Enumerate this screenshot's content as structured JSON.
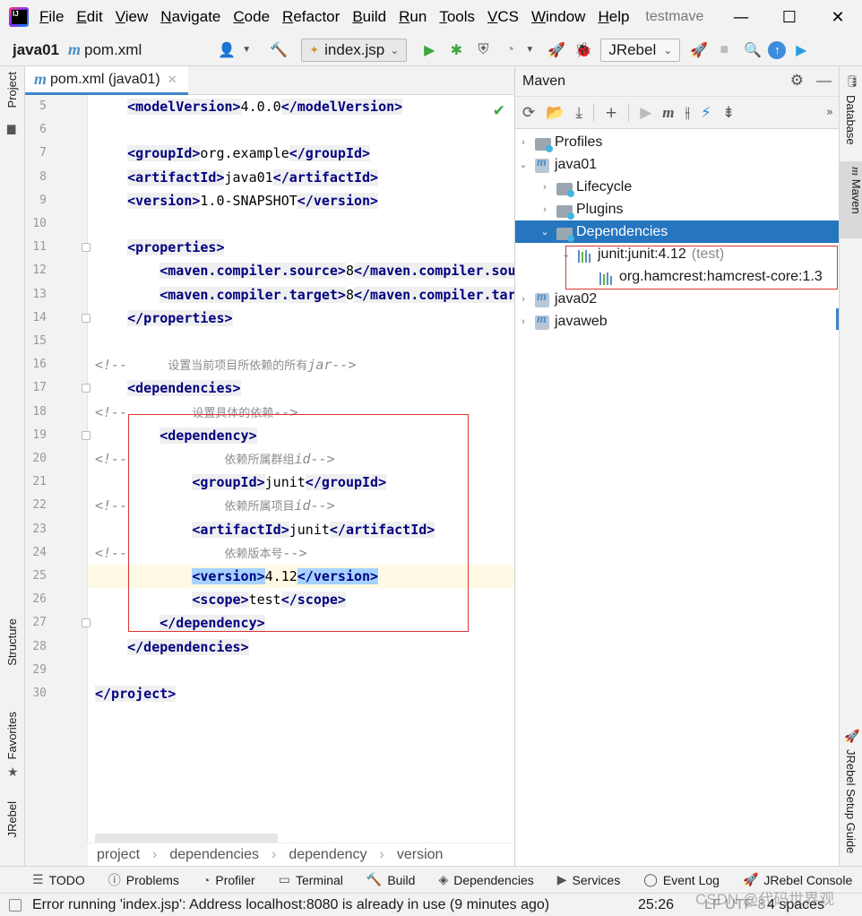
{
  "menubar": {
    "items": [
      "File",
      "Edit",
      "View",
      "Navigate",
      "Code",
      "Refactor",
      "Build",
      "Run",
      "Tools",
      "VCS",
      "Window",
      "Help"
    ],
    "project_title": "testmave"
  },
  "toolbar": {
    "project": "java01",
    "file": "pom.xml",
    "run_config": "index.jsp",
    "jrebel": "JRebel"
  },
  "editor": {
    "tab": "pom.xml (java01)",
    "lines": [
      {
        "n": "5",
        "parts": [
          [
            "tag",
            "<modelVersion>"
          ],
          [
            "txt",
            "4.0.0"
          ],
          [
            "tag",
            "</modelVersion>"
          ]
        ],
        "indent": 4
      },
      {
        "n": "6",
        "parts": [],
        "indent": 0
      },
      {
        "n": "7",
        "parts": [
          [
            "tag",
            "<groupId>"
          ],
          [
            "txt",
            "org.example"
          ],
          [
            "tag",
            "</groupId>"
          ]
        ],
        "indent": 4
      },
      {
        "n": "8",
        "parts": [
          [
            "tag",
            "<artifactId>"
          ],
          [
            "txt",
            "java01"
          ],
          [
            "tag",
            "</artifactId>"
          ]
        ],
        "indent": 4
      },
      {
        "n": "9",
        "parts": [
          [
            "tag",
            "<version>"
          ],
          [
            "txt",
            "1.0-SNAPSHOT"
          ],
          [
            "tag",
            "</version>"
          ]
        ],
        "indent": 4
      },
      {
        "n": "10",
        "parts": [],
        "indent": 0
      },
      {
        "n": "11",
        "parts": [
          [
            "tag",
            "<properties>"
          ]
        ],
        "indent": 4
      },
      {
        "n": "12",
        "parts": [
          [
            "tag",
            "<maven.compiler.source>"
          ],
          [
            "txt",
            "8"
          ],
          [
            "tag",
            "</maven.compiler.sou"
          ]
        ],
        "indent": 8
      },
      {
        "n": "13",
        "parts": [
          [
            "tag",
            "<maven.compiler.target>"
          ],
          [
            "txt",
            "8"
          ],
          [
            "tag",
            "</maven.compiler.tar"
          ]
        ],
        "indent": 8
      },
      {
        "n": "14",
        "parts": [
          [
            "tag",
            "</properties>"
          ]
        ],
        "indent": 4
      },
      {
        "n": "15",
        "parts": [],
        "indent": 0
      },
      {
        "n": "16",
        "parts": [
          [
            "cmt",
            "<!--     "
          ],
          [
            "cmt-cjk",
            "设置当前项目所依赖的所有"
          ],
          [
            "cmt",
            "jar-->"
          ]
        ],
        "indent": 0
      },
      {
        "n": "17",
        "parts": [
          [
            "tag",
            "<dependencies>"
          ]
        ],
        "indent": 4
      },
      {
        "n": "18",
        "parts": [
          [
            "cmt",
            "<!--        "
          ],
          [
            "cmt-cjk",
            "设置具体的依赖"
          ],
          [
            "cmt",
            "-->"
          ]
        ],
        "indent": 0
      },
      {
        "n": "19",
        "parts": [
          [
            "tag",
            "<dependency>"
          ]
        ],
        "indent": 8
      },
      {
        "n": "20",
        "parts": [
          [
            "cmt",
            "<!--            "
          ],
          [
            "cmt-cjk",
            "依赖所属群组"
          ],
          [
            "cmt",
            "id-->"
          ]
        ],
        "indent": 0
      },
      {
        "n": "21",
        "parts": [
          [
            "tag",
            "<groupId>"
          ],
          [
            "txt",
            "junit"
          ],
          [
            "tag",
            "</groupId>"
          ]
        ],
        "indent": 12
      },
      {
        "n": "22",
        "parts": [
          [
            "cmt",
            "<!--            "
          ],
          [
            "cmt-cjk",
            "依赖所属项目"
          ],
          [
            "cmt",
            "id-->"
          ]
        ],
        "indent": 0
      },
      {
        "n": "23",
        "parts": [
          [
            "tag",
            "<artifactId>"
          ],
          [
            "txt",
            "junit"
          ],
          [
            "tag",
            "</artifactId>"
          ]
        ],
        "indent": 12
      },
      {
        "n": "24",
        "parts": [
          [
            "cmt",
            "<!--            "
          ],
          [
            "cmt-cjk",
            "依赖版本号"
          ],
          [
            "cmt",
            "-->"
          ]
        ],
        "indent": 0
      },
      {
        "n": "25",
        "parts": [
          [
            "tagsel",
            "<version>"
          ],
          [
            "txt",
            "4.12"
          ],
          [
            "tagsel",
            "</version>"
          ]
        ],
        "indent": 12
      },
      {
        "n": "26",
        "parts": [
          [
            "tag",
            "<scope>"
          ],
          [
            "txt",
            "test"
          ],
          [
            "tag",
            "</scope>"
          ]
        ],
        "indent": 12
      },
      {
        "n": "27",
        "parts": [
          [
            "tag",
            "</dependency>"
          ]
        ],
        "indent": 8
      },
      {
        "n": "28",
        "parts": [
          [
            "tag",
            "</dependencies>"
          ]
        ],
        "indent": 4
      },
      {
        "n": "29",
        "parts": [],
        "indent": 0
      },
      {
        "n": "30",
        "parts": [
          [
            "tag",
            "</project>"
          ]
        ],
        "indent": 0
      }
    ],
    "breadcrumb": [
      "project",
      "dependencies",
      "dependency",
      "version"
    ]
  },
  "maven": {
    "title": "Maven",
    "tree": [
      {
        "label": "Profiles",
        "depth": 0,
        "arrow": "›",
        "icon": "folder"
      },
      {
        "label": "java01",
        "depth": 0,
        "arrow": "⌄",
        "icon": "module"
      },
      {
        "label": "Lifecycle",
        "depth": 1,
        "arrow": "›",
        "icon": "folder"
      },
      {
        "label": "Plugins",
        "depth": 1,
        "arrow": "›",
        "icon": "folder"
      },
      {
        "label": "Dependencies",
        "depth": 1,
        "arrow": "⌄",
        "icon": "folder",
        "selected": true
      },
      {
        "label": "junit:junit:4.12",
        "suffix": "(test)",
        "depth": 2,
        "arrow": "⌄",
        "icon": "lib"
      },
      {
        "label": "org.hamcrest:hamcrest-core:1.3",
        "depth": 3,
        "arrow": "",
        "icon": "lib"
      },
      {
        "label": "java02",
        "depth": 0,
        "arrow": "›",
        "icon": "module"
      },
      {
        "label": "javaweb",
        "depth": 0,
        "arrow": "›",
        "icon": "module"
      }
    ]
  },
  "stripes": {
    "left_top": "Project",
    "left_structure": "Structure",
    "left_favorites": "Favorites",
    "left_jrebel": "JRebel",
    "right_database": "Database",
    "right_maven": "Maven",
    "right_jrebel_guide": "JRebel Setup Guide"
  },
  "tool_windows": [
    "TODO",
    "Problems",
    "Profiler",
    "Terminal",
    "Build",
    "Dependencies",
    "Services",
    "Event Log",
    "JRebel Console"
  ],
  "status": {
    "message": "Error running 'index.jsp': Address localhost:8080 is already in use (9 minutes ago)",
    "position": "25:26",
    "line_sep": "LF  UTF-8",
    "indent": "4 spaces",
    "watermark": "CSDN @代码世界观"
  }
}
